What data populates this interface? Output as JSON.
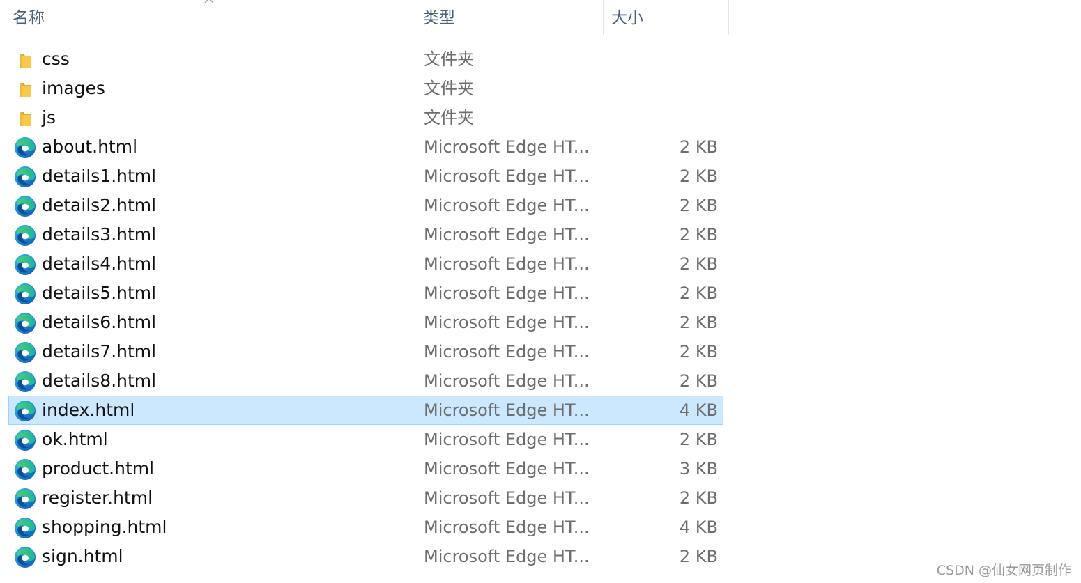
{
  "header": {
    "name_label": "名称",
    "type_label": "类型",
    "size_label": "大小"
  },
  "files": [
    {
      "name": "css",
      "type": "文件夹",
      "size": "",
      "icon": "folder-icon"
    },
    {
      "name": "images",
      "type": "文件夹",
      "size": "",
      "icon": "folder-icon"
    },
    {
      "name": "js",
      "type": "文件夹",
      "size": "",
      "icon": "folder-icon"
    },
    {
      "name": "about.html",
      "type": "Microsoft Edge HT...",
      "size": "2 KB",
      "icon": "edge-html-icon"
    },
    {
      "name": "details1.html",
      "type": "Microsoft Edge HT...",
      "size": "2 KB",
      "icon": "edge-html-icon"
    },
    {
      "name": "details2.html",
      "type": "Microsoft Edge HT...",
      "size": "2 KB",
      "icon": "edge-html-icon"
    },
    {
      "name": "details3.html",
      "type": "Microsoft Edge HT...",
      "size": "2 KB",
      "icon": "edge-html-icon"
    },
    {
      "name": "details4.html",
      "type": "Microsoft Edge HT...",
      "size": "2 KB",
      "icon": "edge-html-icon"
    },
    {
      "name": "details5.html",
      "type": "Microsoft Edge HT...",
      "size": "2 KB",
      "icon": "edge-html-icon"
    },
    {
      "name": "details6.html",
      "type": "Microsoft Edge HT...",
      "size": "2 KB",
      "icon": "edge-html-icon"
    },
    {
      "name": "details7.html",
      "type": "Microsoft Edge HT...",
      "size": "2 KB",
      "icon": "edge-html-icon"
    },
    {
      "name": "details8.html",
      "type": "Microsoft Edge HT...",
      "size": "2 KB",
      "icon": "edge-html-icon"
    },
    {
      "name": "index.html",
      "type": "Microsoft Edge HT...",
      "size": "4 KB",
      "icon": "edge-html-icon",
      "selected": true
    },
    {
      "name": "ok.html",
      "type": "Microsoft Edge HT...",
      "size": "2 KB",
      "icon": "edge-html-icon"
    },
    {
      "name": "product.html",
      "type": "Microsoft Edge HT...",
      "size": "3 KB",
      "icon": "edge-html-icon"
    },
    {
      "name": "register.html",
      "type": "Microsoft Edge HT...",
      "size": "2 KB",
      "icon": "edge-html-icon"
    },
    {
      "name": "shopping.html",
      "type": "Microsoft Edge HT...",
      "size": "4 KB",
      "icon": "edge-html-icon"
    },
    {
      "name": "sign.html",
      "type": "Microsoft Edge HT...",
      "size": "2 KB",
      "icon": "edge-html-icon"
    }
  ],
  "watermark": "CSDN @仙女网页制作",
  "colors": {
    "selection_bg": "#cce8ff",
    "selection_border": "#99d1ff",
    "header_text": "#4c607a",
    "secondary_text": "#6d6d6d",
    "folder_yellow": "#f8c94a"
  }
}
